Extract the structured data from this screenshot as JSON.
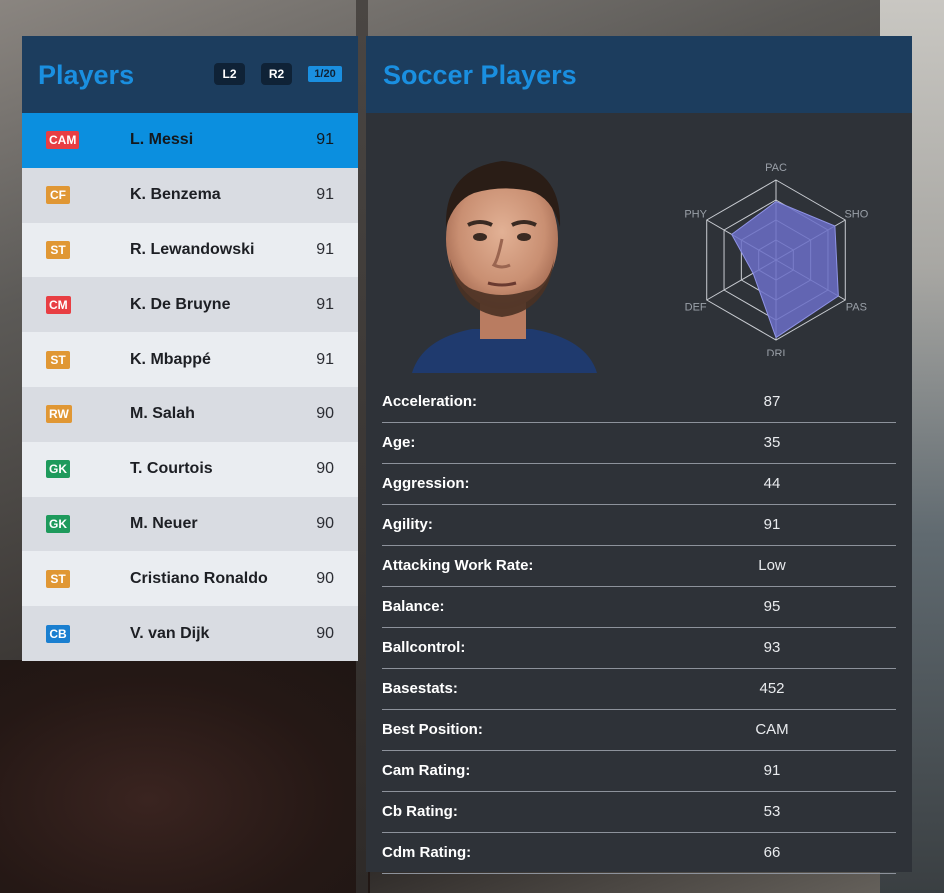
{
  "players_panel": {
    "title": "Players",
    "l2_label": "L2",
    "r2_label": "R2",
    "page_indicator": "1/20",
    "players": [
      {
        "position": "CAM",
        "name": "L. Messi",
        "rating": "91",
        "color": "#e83e43"
      },
      {
        "position": "CF",
        "name": "K. Benzema",
        "rating": "91",
        "color": "#e09734"
      },
      {
        "position": "ST",
        "name": "R. Lewandowski",
        "rating": "91",
        "color": "#e09734"
      },
      {
        "position": "CM",
        "name": "K. De Bruyne",
        "rating": "91",
        "color": "#e83e43"
      },
      {
        "position": "ST",
        "name": "K. Mbappé",
        "rating": "91",
        "color": "#e09734"
      },
      {
        "position": "RW",
        "name": "M. Salah",
        "rating": "90",
        "color": "#e09734"
      },
      {
        "position": "GK",
        "name": "T. Courtois",
        "rating": "90",
        "color": "#1e9a5c"
      },
      {
        "position": "GK",
        "name": "M. Neuer",
        "rating": "90",
        "color": "#1e9a5c"
      },
      {
        "position": "ST",
        "name": "Cristiano Ronaldo",
        "rating": "90",
        "color": "#e09734"
      },
      {
        "position": "CB",
        "name": "V. van Dijk",
        "rating": "90",
        "color": "#1a7fd0"
      }
    ]
  },
  "detail_panel": {
    "title": "Soccer Players",
    "radar": {
      "labels": [
        "PAC",
        "SHO",
        "PAS",
        "DRI",
        "DEF",
        "PHY"
      ],
      "values": [
        0.73,
        0.85,
        0.9,
        0.97,
        0.33,
        0.64
      ],
      "fill_color": "#6b6fc8"
    },
    "stats": [
      {
        "label": "Acceleration:",
        "value": "87"
      },
      {
        "label": "Age:",
        "value": "35"
      },
      {
        "label": "Aggression:",
        "value": "44"
      },
      {
        "label": "Agility:",
        "value": "91"
      },
      {
        "label": "Attacking Work Rate:",
        "value": "Low"
      },
      {
        "label": "Balance:",
        "value": "95"
      },
      {
        "label": "Ballcontrol:",
        "value": "93"
      },
      {
        "label": "Basestats:",
        "value": "452"
      },
      {
        "label": "Best Position:",
        "value": "CAM"
      },
      {
        "label": "Cam Rating:",
        "value": "91"
      },
      {
        "label": "Cb Rating:",
        "value": "53"
      },
      {
        "label": "Cdm Rating:",
        "value": "66"
      }
    ]
  }
}
